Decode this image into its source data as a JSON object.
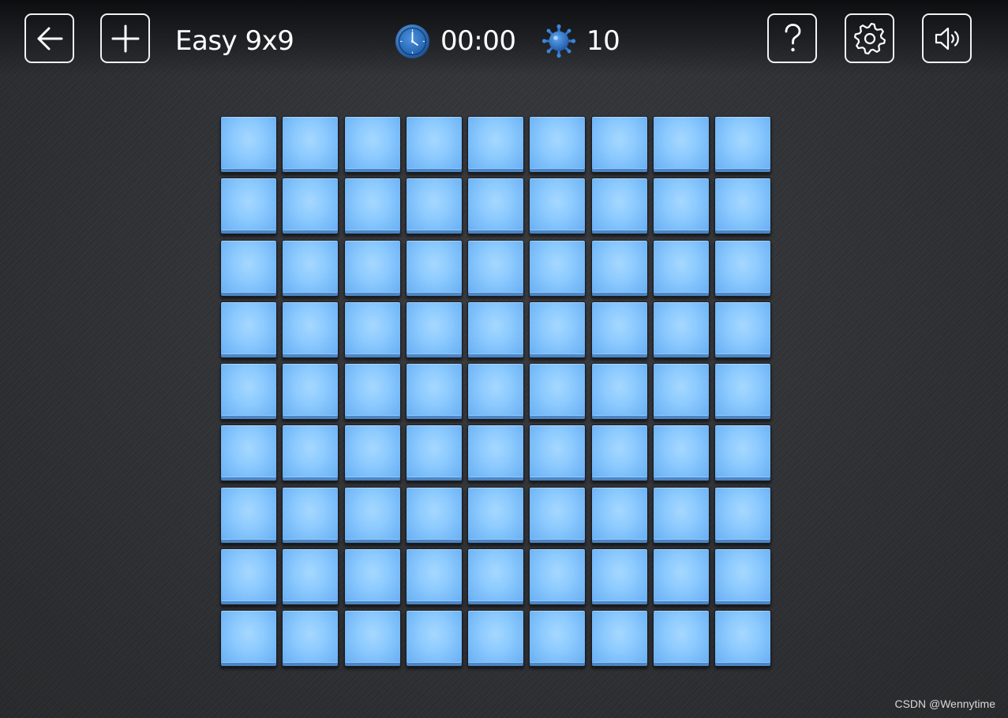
{
  "header": {
    "title": "Easy 9x9",
    "timer": "00:00",
    "mine_count": "10",
    "buttons": [
      {
        "icon": "back-arrow-icon"
      },
      {
        "icon": "plus-icon"
      },
      {
        "icon": "question-mark-icon"
      },
      {
        "icon": "gear-icon"
      },
      {
        "icon": "speaker-icon"
      }
    ],
    "timer_icon": "clock-icon",
    "mines_icon": "mine-icon"
  },
  "board": {
    "rows": 9,
    "columns": 9,
    "cell_state": "unrevealed",
    "cell_color": "#8ccaff",
    "cell_edge_color": "#4c86c4"
  },
  "background_color": "#323438",
  "watermark": "CSDN @Wennytime"
}
